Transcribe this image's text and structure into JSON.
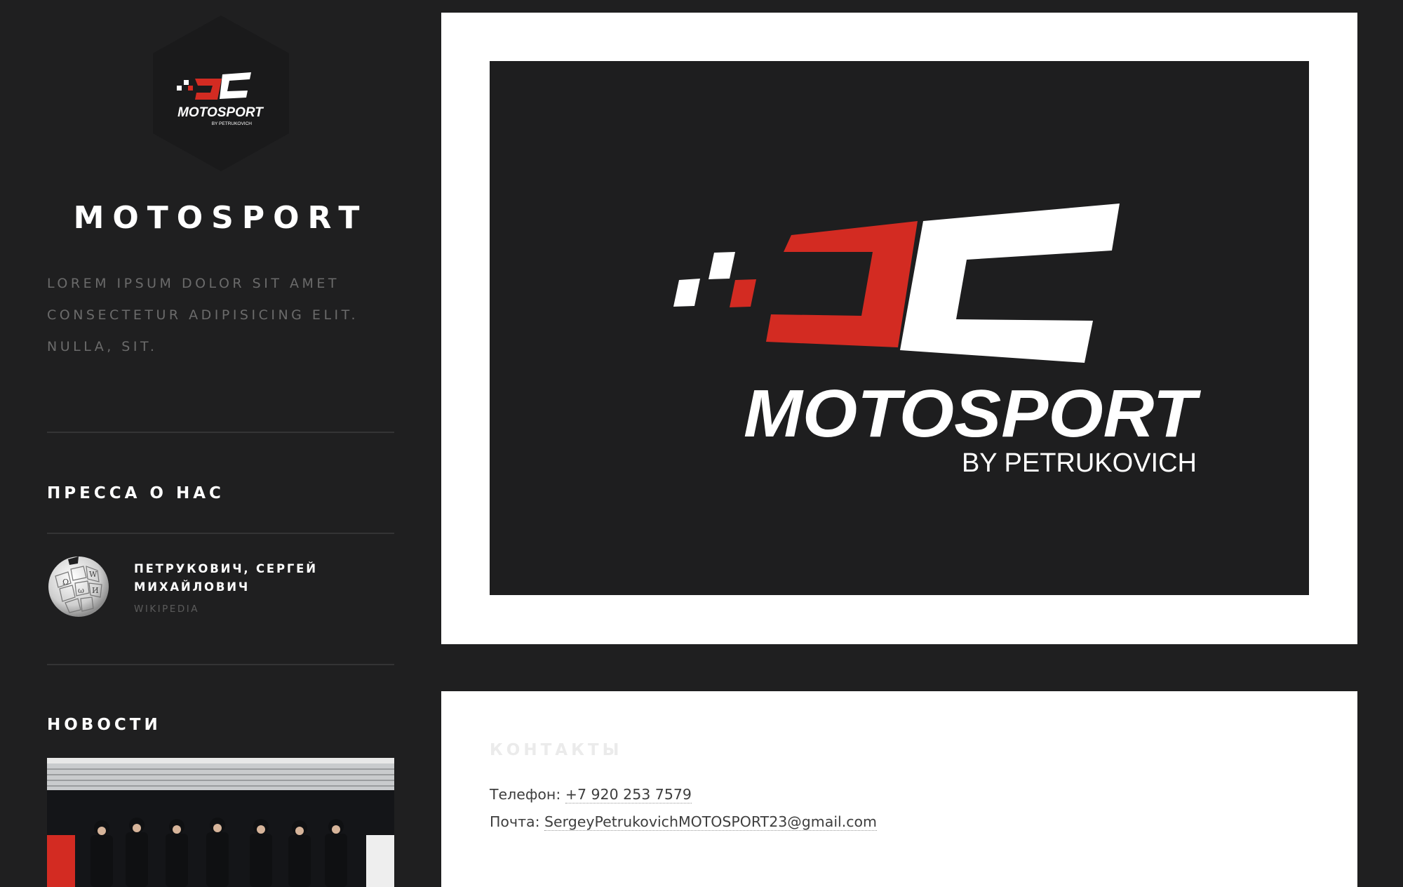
{
  "site": {
    "title": "MOTOSPORT",
    "tagline": "LOREM IPSUM DOLOR SIT AMET CONSECTETUR ADIPISICING ELIT. NULLA, SIT.",
    "logo_text": "MOTOSPORT",
    "logo_subtext": "BY PETRUKOVICH"
  },
  "sidebar": {
    "press": {
      "heading": "ПРЕССА О НАС",
      "items": [
        {
          "title": "ПЕТРУКОВИЧ, СЕРГЕЙ МИХАЙЛОВИЧ",
          "source": "WIKIPEDIA",
          "icon": "wikipedia-globe-icon"
        }
      ]
    },
    "news": {
      "heading": "НОВОСТИ"
    }
  },
  "hero": {
    "logo_text": "MOTOSPORT",
    "logo_subtext": "BY PETRUKOVICH"
  },
  "contacts": {
    "heading": "КОНТАКТЫ",
    "phone_label": "Телефон:",
    "phone": "+7 920 253 7579",
    "email_label": "Почта:",
    "email": "SergeyPetrukovichMOTOSPORT23@gmail.com"
  },
  "colors": {
    "background": "#1f1f20",
    "brand_red": "#d32b22",
    "card": "#ffffff",
    "text_muted": "#6b6b6b"
  }
}
